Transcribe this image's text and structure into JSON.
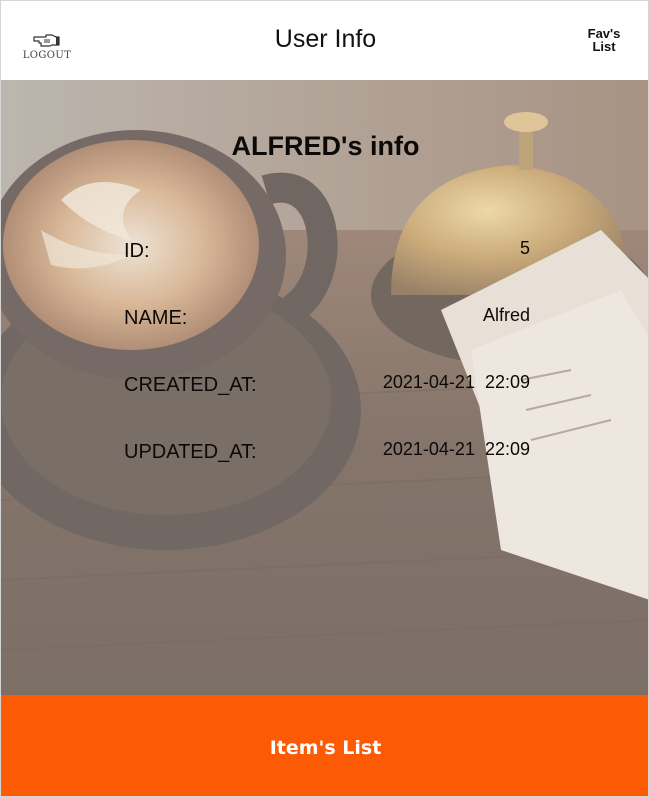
{
  "header": {
    "logout_label": "LOGOUT",
    "title": "User Info",
    "favs_line1": "Fav's",
    "favs_line2": "List"
  },
  "main": {
    "heading": "ALFRED's info",
    "fields": [
      {
        "label": "ID:",
        "value": "5"
      },
      {
        "label": "NAME:",
        "value": "Alfred"
      },
      {
        "label": "CREATED_AT:",
        "value": "2021-04-21  22:09"
      },
      {
        "label": "UPDATED_AT:",
        "value": "2021-04-21  22:09"
      }
    ],
    "background_image": "coffee-cup-and-service-bell"
  },
  "footer": {
    "button_label": "Item's List"
  },
  "colors": {
    "accent": "#fd5a06",
    "header_bg": "#ffffff",
    "text": "#0c0a08"
  },
  "icons": {
    "logout": "pointing-hand-icon"
  }
}
